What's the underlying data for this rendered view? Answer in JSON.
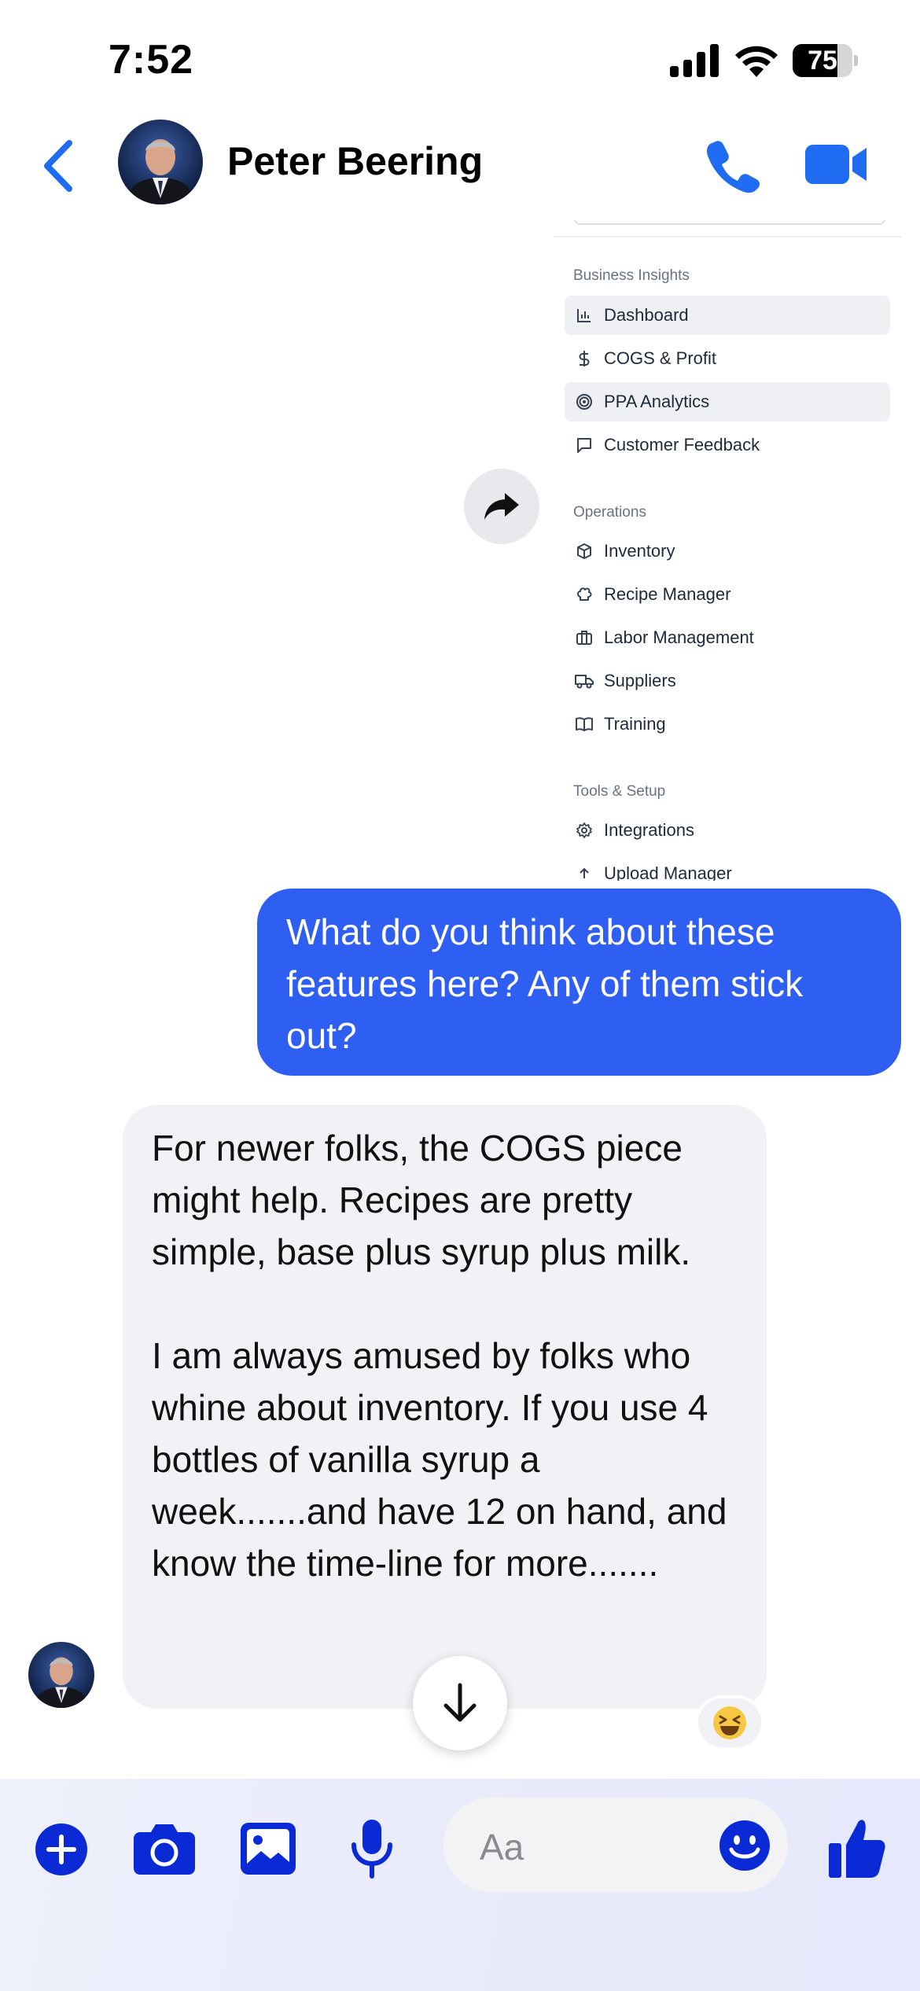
{
  "status_bar": {
    "time": "7:52",
    "battery": "75"
  },
  "header": {
    "contact_name": "Peter Beering"
  },
  "attachment": {
    "sections": [
      {
        "title": "Business Insights",
        "items": [
          {
            "label": "Dashboard",
            "icon": "bar-chart-icon",
            "active": true
          },
          {
            "label": "COGS & Profit",
            "icon": "dollar-icon",
            "active": false
          },
          {
            "label": "PPA Analytics",
            "icon": "target-icon",
            "active": true
          },
          {
            "label": "Customer Feedback",
            "icon": "message-square-icon",
            "active": false
          }
        ]
      },
      {
        "title": "Operations",
        "items": [
          {
            "label": "Inventory",
            "icon": "box-icon",
            "active": false
          },
          {
            "label": "Recipe Manager",
            "icon": "chef-hat-icon",
            "active": false
          },
          {
            "label": "Labor Management",
            "icon": "briefcase-icon",
            "active": false
          },
          {
            "label": "Suppliers",
            "icon": "truck-icon",
            "active": false
          },
          {
            "label": "Training",
            "icon": "book-icon",
            "active": false
          }
        ]
      },
      {
        "title": "Tools & Setup",
        "items": [
          {
            "label": "Integrations",
            "icon": "gear-icon",
            "active": false
          },
          {
            "label": "Upload Manager",
            "icon": "upload-icon",
            "active": false
          }
        ]
      }
    ]
  },
  "messages": {
    "outgoing": "What do you think about these features here? Any of them stick out?",
    "incoming": "For newer folks, the COGS piece might help. Recipes are pretty simple, base plus syrup plus milk.\n\nI am always amused by folks who whine about inventory. If you use 4 bottles of vanilla syrup a week.......and have 12 on hand, and know the time-line for more.......",
    "reaction": "😆"
  },
  "composer": {
    "placeholder": "Aa"
  },
  "colors": {
    "accent": "#2f5ef3",
    "composer_icon": "#0a2ad6",
    "header_icon": "#1f6bf2"
  }
}
